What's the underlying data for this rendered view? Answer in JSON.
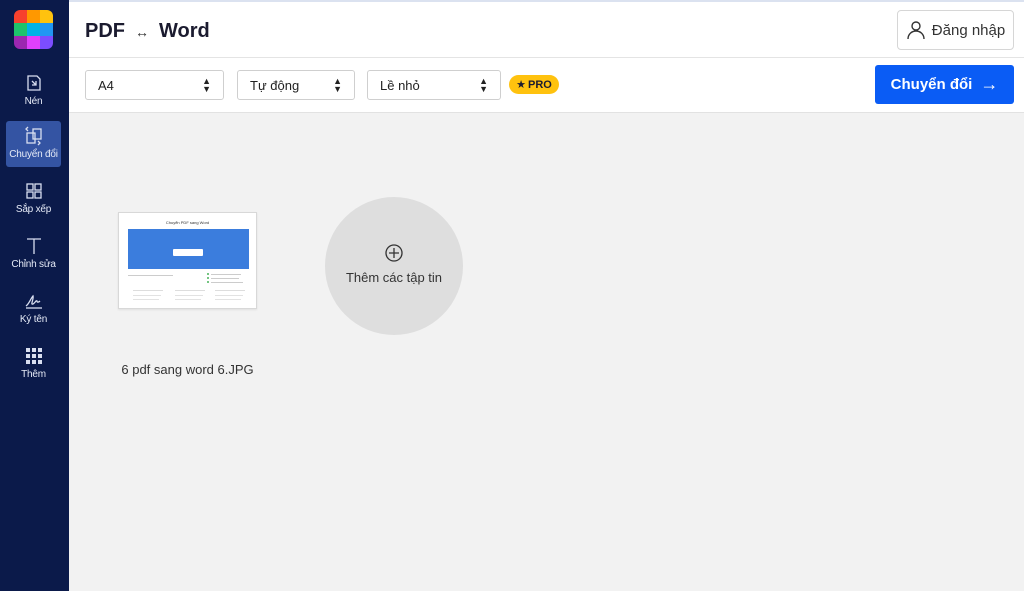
{
  "app": {
    "title_left": "PDF",
    "title_arrow": "↔",
    "title_right": "Word",
    "login_label": "Đăng nhập",
    "logo_colors": [
      "#f7412d",
      "#ff9800",
      "#ffc20e",
      "#1ec36b",
      "#00b3e6",
      "#2196f3",
      "#9c27b0",
      "#e040fb",
      "#7c4dff"
    ]
  },
  "sidebar": {
    "items": [
      {
        "label": "Nén",
        "icon": "compress-icon"
      },
      {
        "label": "Chuyển đổi",
        "icon": "convert-icon",
        "active": true
      },
      {
        "label": "Sắp xếp",
        "icon": "grid-icon"
      },
      {
        "label": "Chỉnh sửa",
        "icon": "text-icon"
      },
      {
        "label": "Ký tên",
        "icon": "signature-icon"
      },
      {
        "label": "Thêm",
        "icon": "more-icon"
      }
    ]
  },
  "toolbar": {
    "page_size": "A4",
    "orientation": "Tự động",
    "margin": "Lề nhỏ",
    "pro_label": "PRO",
    "convert_label": "Chuyển đổi",
    "convert_arrow": "→"
  },
  "main": {
    "file": {
      "name": "6 pdf sang word 6.JPG",
      "thumb_title": "Chuyển PDF sang Word"
    },
    "add_files_label": "Thêm các tập tin"
  },
  "colors": {
    "sidebar_bg": "#0b1a4a",
    "accent": "#0a5cf5",
    "pro_badge": "#ffc20e"
  }
}
